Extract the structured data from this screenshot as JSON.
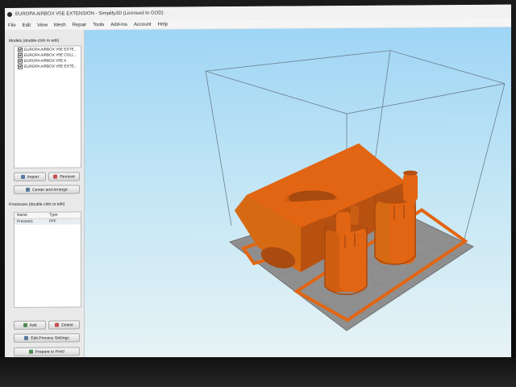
{
  "window": {
    "title": "EUROPA AIRBOX V5E EXTENSION - Simplify3D (Licensed to GOD)"
  },
  "menu": {
    "items": [
      "File",
      "Edit",
      "View",
      "Mesh",
      "Repair",
      "Tools",
      "Add-Ins",
      "Account",
      "Help"
    ]
  },
  "models": {
    "section_title": "Models (double-click to edit)",
    "items": [
      "EUROPA AIRBOX V5E EXTE...",
      "EUROPA AIRBOX V5E COLL...",
      "EUROPA AIRBOX V5E A",
      "EUROPA AIRBOX V5E EXTE..."
    ],
    "import_label": "Import",
    "remove_label": "Remove",
    "center_label": "Center and Arrange"
  },
  "processes": {
    "section_title": "Processes (double-click to edit)",
    "col_name": "Name",
    "col_type": "Type",
    "row_name": "Process1",
    "row_type": "FFF",
    "add_label": "Add",
    "delete_label": "Delete",
    "edit_label": "Edit Process Settings",
    "prepare_label": "Prepare to Print!"
  },
  "colors": {
    "accent_orange": "#e26513",
    "bed_gray": "#8f8f8f",
    "sky_blue": "#a9dbf5"
  }
}
